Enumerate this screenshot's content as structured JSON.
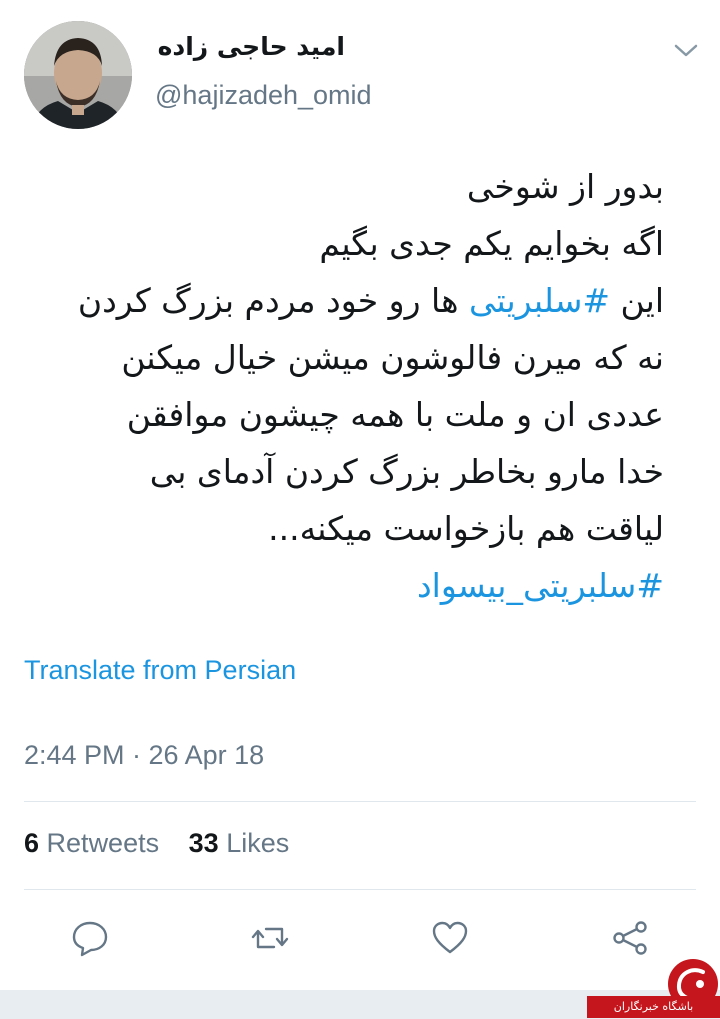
{
  "tweet": {
    "display_name": "امید حاجی زاده",
    "handle": "@hajizadeh_omid",
    "body_lines": {
      "l1": "بدور از شوخی",
      "l2": "اگه بخوایم یکم جدی بگیم",
      "l3_prefix": "این ",
      "l3_hashtag": "#سلبریتی",
      "l3_suffix": " ها رو خود مردم بزرگ کردن",
      "l4": "نه که میرن فالوشون میشن خیال میکنن",
      "l5": "عددی ان و ملت با همه چیشون موافقن",
      "l6": "خدا مارو بخاطر بزرگ کردن آدمای بی",
      "l7": "لیاقت هم بازخواست میکنه...",
      "l8_hashtag": "#سلبریتی_بیسواد"
    },
    "translate_label": "Translate from Persian",
    "timestamp": "2:44 PM · 26 Apr 18",
    "stats": {
      "retweets_count": "6",
      "retweets_label": "Retweets",
      "likes_count": "33",
      "likes_label": "Likes"
    }
  },
  "actions": {
    "icons": [
      "reply-icon",
      "retweet-icon",
      "like-icon",
      "share-icon"
    ]
  },
  "watermark": {
    "text": "باشگاه خبرنگاران"
  },
  "colors": {
    "link": "#1b95e0",
    "secondary_text": "#657786",
    "primary_text": "#14171a",
    "divider": "#e1e8ed",
    "icon": "#657786",
    "watermark_red": "#c4161c"
  }
}
